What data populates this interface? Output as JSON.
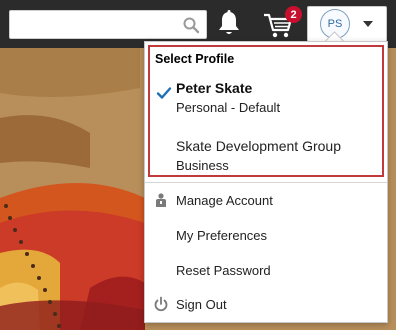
{
  "header": {
    "search": {
      "placeholder": "",
      "value": ""
    },
    "cart": {
      "badge_count": "2"
    },
    "profile": {
      "initials": "PS"
    }
  },
  "profile_menu": {
    "section_title": "Select Profile",
    "profiles": [
      {
        "name": "Peter Skate",
        "type": "Personal - Default",
        "selected": true
      },
      {
        "name": "Skate Development Group",
        "type": "Business",
        "selected": false
      }
    ],
    "items": [
      {
        "label": "Manage Account",
        "icon": "person-icon"
      },
      {
        "label": "My Preferences",
        "icon": ""
      },
      {
        "label": "Reset Password",
        "icon": ""
      },
      {
        "label": "Sign Out",
        "icon": "power-icon"
      }
    ]
  },
  "colors": {
    "topbar": "#2b2b2b",
    "badge": "#c8102e",
    "highlight_border": "#c0393b",
    "check": "#1f6fb5"
  }
}
